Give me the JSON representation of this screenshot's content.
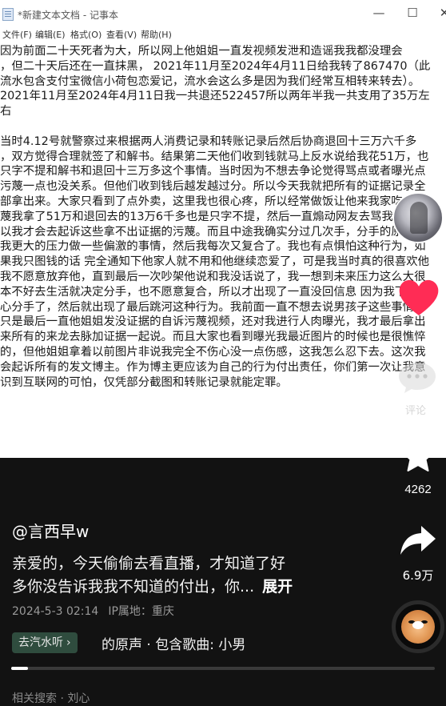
{
  "notepad": {
    "title": "*新建文本文档 - 记事本",
    "window_buttons": [
      "—",
      "☐",
      "✕"
    ],
    "menu": [
      "文件(F)",
      "编辑(E)",
      "格式(O)",
      "查看(V)",
      "帮助(H)"
    ],
    "lines": [
      "   因为前面二十天死者为大，所以网上他姐姐一直发视频发泄和造谣我我都没理会",
      "，但二十天后还在一直抹黑，     2021年11月至2024年4月11日给我转了867470（此",
      "流水包含支付宝微信小荷包恋爱记，流水会这么多是因为我们经常互相转来转去）。",
      "2021年11月至2024年4月11日我一共退还522457所以两年半我一共支用了35万左",
      "右",
      "",
      " 当时4.12号就警察过来根据两人消费记录和转账记录后然后协商退回十三万六千多",
      "，双方觉得合理就签了和解书。结果第二天他们收到钱就马上反水说给我花51万，也",
      "只字不提和解书和退回十三万多这个事情。当时因为不想去争论觉得骂点或者曝光点",
      "污蔑一点也没关系。但他们收到钱后越发越过分。所以今天我就把所有的证据记录全",
      "部拿出来。大家只看到了点外卖，这里我也很心疼，所以经常做饭让他来我家吃。污",
      "蔑我拿了51万和退回去的13万6千多也是只字不提，然后一直煽动网友去骂我。所",
      "以我才会去起诉这些拿不出证据的污蔑。而且中途我确实分过几次手，分手的原因是",
      "我更大的压力做一些偏激的事情，然后我每次又复合了。我也有点惧怕这种行为，如",
      "果我只图钱的话 完全通知下他家人就不用和他继续恋爱了，可是我当时真的很喜欢他",
      "我不愿意放弃他，直到最后一次吵架他说和我没话说了，我一想到未来压力这么大很",
      "本不好去生活就决定分手，也不愿意复合，所以才出现了一直没回信息 因为我下定决",
      "心分手了，然后就出现了最后跳河这种行为。我前面一直不想去说男孩子这些事情，",
      "只是最后一直他姐姐发没证据的自诉污蔑视频，还对我进行人肉曝光，我才最后拿出",
      "来所有的来龙去脉加证据一起说。而且大家也看到曝光我最近图片的时候也是很憔悴",
      "的，但他姐姐拿着以前图片非说我完全不伤心没一点伤感，这我怎么忍下去。这次我",
      "会起诉所有的发文博主。作为博主更应该为自己的行为付出责任，你们第一次让我意",
      "识到互联网的可怕，仅凭部分截图和转账记录就能定罪。"
    ]
  },
  "sidebar": {
    "comment_label": "评论",
    "favorite_count": "4262",
    "share_count": "6.9万",
    "icons": [
      "avatar",
      "heart-icon",
      "comment-icon",
      "star-icon",
      "share-icon",
      "music-disc"
    ]
  },
  "post": {
    "author": "@言西早w",
    "caption_line1": "亲爱的，今天偷偷去看直播，才知道了好",
    "caption_line2": "多你没告诉我我不知道的付出，你...",
    "expand": "展开",
    "date": "2024-5-3 02:14",
    "ip": "IP属地：重庆",
    "tag": "去汽水听",
    "tag_arrow": "›",
    "music": "的原声 · 包含歌曲: 小男",
    "bottom_hint": "相关搜索 · 刘心"
  },
  "progress": {
    "fraction": 0.04
  },
  "colors": {
    "background": "#121212",
    "like": "#ff2c55",
    "tag_bg": "#2f4c3e"
  }
}
